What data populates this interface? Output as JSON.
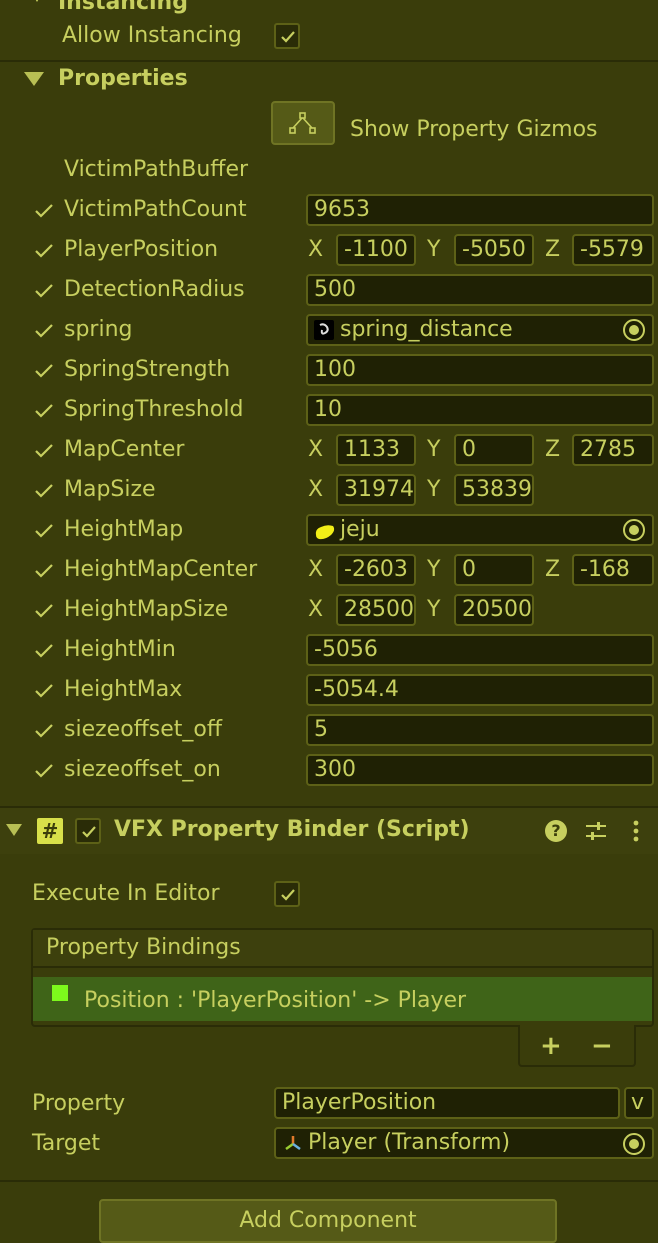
{
  "instancing": {
    "header_label": "Instancing",
    "allow_label": "Allow Instancing",
    "allow_checked": true
  },
  "properties": {
    "header_label": "Properties",
    "gizmo_button_label": "Show Property Gizmos",
    "buffer_label": "VictimPathBuffer",
    "rows": [
      {
        "label": "VictimPathCount",
        "value": "9653"
      },
      {
        "label": "PlayerPosition",
        "x": "-1100",
        "y": "-5050",
        "z": "-5579"
      },
      {
        "label": "DetectionRadius",
        "value": "500"
      },
      {
        "label": "spring",
        "object": "spring_distance"
      },
      {
        "label": "SpringStrength",
        "value": "100"
      },
      {
        "label": "SpringThreshold",
        "value": "10"
      },
      {
        "label": "MapCenter",
        "x": "1133",
        "y": "0",
        "z": "2785"
      },
      {
        "label": "MapSize",
        "x": "31974",
        "y": "53839"
      },
      {
        "label": "HeightMap",
        "object": "jeju"
      },
      {
        "label": "HeightMapCenter",
        "x": "-2603",
        "y": "0",
        "z": "-168"
      },
      {
        "label": "HeightMapSize",
        "x": "28500",
        "y": "20500"
      },
      {
        "label": "HeightMin",
        "value": "-5056"
      },
      {
        "label": "HeightMax",
        "value": "-5054.4"
      },
      {
        "label": "siezeoffset_off",
        "value": "5"
      },
      {
        "label": "siezeoffset_on",
        "value": "300"
      }
    ],
    "axis_x": "X",
    "axis_y": "Y",
    "axis_z": "Z"
  },
  "binder": {
    "title": "VFX Property Binder (Script)",
    "execute_label": "Execute In Editor",
    "bindings_header": "Property Bindings",
    "binding_item": "Position : 'PlayerPosition' -> Player",
    "add_label": "+",
    "remove_label": "−",
    "property_label": "Property",
    "property_value": "PlayerPosition",
    "property_dropdown": "v",
    "target_label": "Target",
    "target_value": "Player (Transform)"
  },
  "add_component_label": "Add Component",
  "colors": {
    "background": "#3a3d0b",
    "text": "#c7cf5f",
    "field": "#1f2104",
    "selected_row": "#3f6418",
    "script_icon": "#d8e04a"
  }
}
